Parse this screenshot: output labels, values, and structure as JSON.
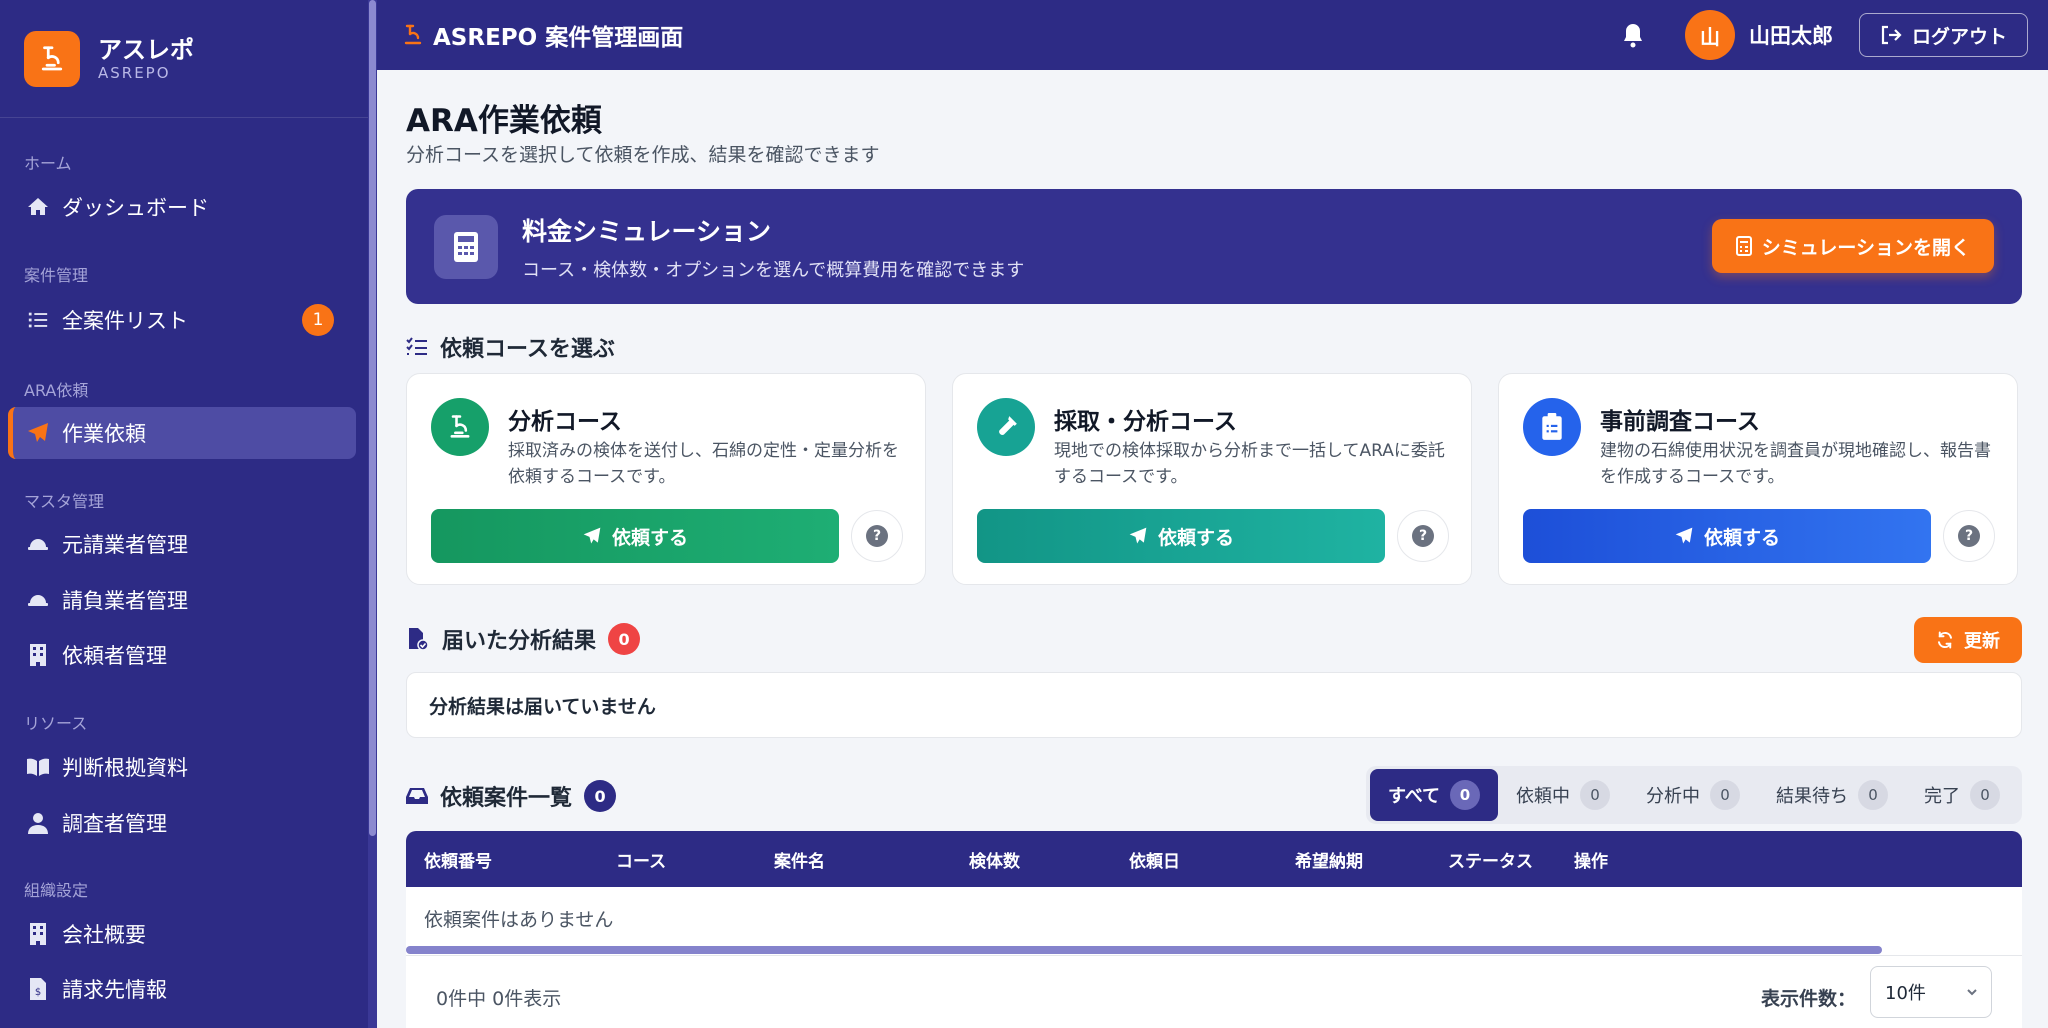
{
  "brand": {
    "name": "アスレポ",
    "sub": "ASREPO"
  },
  "sidebar": {
    "sections": [
      {
        "label": "ホーム",
        "items": [
          {
            "label": "ダッシュボード",
            "icon": "home-icon"
          }
        ]
      },
      {
        "label": "案件管理",
        "items": [
          {
            "label": "全案件リスト",
            "icon": "list-icon",
            "badge": "1"
          }
        ]
      },
      {
        "label": "ARA依頼",
        "items": [
          {
            "label": "作業依頼",
            "icon": "paper-plane-icon",
            "active": true
          }
        ]
      },
      {
        "label": "マスタ管理",
        "items": [
          {
            "label": "元請業者管理",
            "icon": "hardhat-icon"
          },
          {
            "label": "請負業者管理",
            "icon": "hardhat-icon"
          },
          {
            "label": "依頼者管理",
            "icon": "building-icon"
          }
        ]
      },
      {
        "label": "リソース",
        "items": [
          {
            "label": "判断根拠資料",
            "icon": "book-icon"
          },
          {
            "label": "調査者管理",
            "icon": "user-icon"
          }
        ]
      },
      {
        "label": "組織設定",
        "items": [
          {
            "label": "会社概要",
            "icon": "building-icon"
          },
          {
            "label": "請求先情報",
            "icon": "invoice-icon"
          }
        ]
      }
    ]
  },
  "topbar": {
    "title": "ASREPO 案件管理画面",
    "avatar_initial": "山",
    "username": "山田太郎",
    "logout_label": "ログアウト"
  },
  "page": {
    "title": "ARA作業依頼",
    "subtitle": "分析コースを選択して依頼を作成、結果を確認できます"
  },
  "simulation": {
    "title": "料金シミュレーション",
    "description": "コース・検体数・オプションを選んで概算費用を確認できます",
    "button_label": "シミュレーションを開く"
  },
  "courses_section": {
    "title": "依頼コースを選ぶ"
  },
  "courses": [
    {
      "title": "分析コース",
      "description": "採取済みの検体を送付し、石綿の定性・定量分析を依頼するコースです。",
      "button_label": "依頼する",
      "color": "#16a06a",
      "icon": "microscope-icon"
    },
    {
      "title": "採取・分析コース",
      "description": "現地での検体採取から分析まで一括してARAに委託するコースです。",
      "button_label": "依頼する",
      "color": "#17a394",
      "icon": "vial-icon"
    },
    {
      "title": "事前調査コース",
      "description": "建物の石綿使用状況を調査員が現地確認し、報告書を作成するコースです。",
      "button_label": "依頼する",
      "color": "#2563eb",
      "icon": "clipboard-icon"
    }
  ],
  "results": {
    "title": "届いた分析結果",
    "count": "0",
    "refresh_label": "更新",
    "empty_text": "分析結果は届いていません"
  },
  "requests": {
    "title": "依頼案件一覧",
    "count": "0",
    "filters": [
      {
        "label": "すべて",
        "count": "0",
        "active": true
      },
      {
        "label": "依頼中",
        "count": "0"
      },
      {
        "label": "分析中",
        "count": "0"
      },
      {
        "label": "結果待ち",
        "count": "0"
      },
      {
        "label": "完了",
        "count": "0"
      }
    ],
    "columns": [
      "依頼番号",
      "コース",
      "案件名",
      "検体数",
      "依頼日",
      "希望納期",
      "ステータス",
      "操作"
    ],
    "empty_text": "依頼案件はありません",
    "footer_info": "0件中 0件表示",
    "page_size_label": "表示件数：",
    "page_size_value": "10件"
  },
  "colors": {
    "navy": "#2d2b85",
    "accent": "#f97316",
    "danger": "#ef4444"
  }
}
